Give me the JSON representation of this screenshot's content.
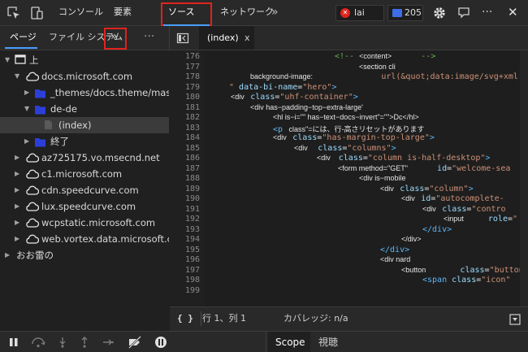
{
  "toolbar": {
    "tabs": [
      "コンソール",
      "要素",
      "ソース",
      "ネットワーク"
    ],
    "more": "»",
    "issues_count": "lai",
    "messages_count": "205",
    "overflow": "···",
    "close": "✕"
  },
  "left_panel": {
    "tabs": [
      "ページ",
      "ファイル システム"
    ],
    "more": "»",
    "overflow": "···"
  },
  "editor": {
    "file_tab": "(index)",
    "file_tab_close": "x"
  },
  "tree": [
    {
      "label": "上",
      "level": 0,
      "arrow": "down",
      "icon": "frame-icon"
    },
    {
      "label": "docs.microsoft.com",
      "level": 1,
      "arrow": "down",
      "icon": "cloud-icon"
    },
    {
      "label": "_themes/docs.theme/maste",
      "level": 2,
      "arrow": "right",
      "icon": "folder-icon"
    },
    {
      "label": "de-de",
      "level": 2,
      "arrow": "down",
      "icon": "folder-icon"
    },
    {
      "label": "(index)",
      "level": 3,
      "arrow": "",
      "icon": "file-icon",
      "selected": true
    },
    {
      "label": "終了",
      "level": 2,
      "arrow": "right",
      "icon": "folder-icon"
    },
    {
      "label": "az725175.vo.msecnd.net",
      "level": 1,
      "arrow": "right",
      "icon": "cloud-icon"
    },
    {
      "label": "c1.microsoft.com",
      "level": 1,
      "arrow": "right",
      "icon": "cloud-icon"
    },
    {
      "label": "cdn.speedcurve.com",
      "level": 1,
      "arrow": "right",
      "icon": "cloud-icon"
    },
    {
      "label": "lux.speedcurve.com",
      "level": 1,
      "arrow": "right",
      "icon": "cloud-icon"
    },
    {
      "label": "wcpstatic.microsoft.com",
      "level": 1,
      "arrow": "right",
      "icon": "cloud-icon"
    },
    {
      "label": "web.vortex.data.microsoft.co",
      "level": 1,
      "arrow": "right",
      "icon": "cloud-icon"
    },
    {
      "label": "おお雷の",
      "level": 0,
      "arrow": "right",
      "icon": ""
    }
  ],
  "code": {
    "line_numbers": [
      "176",
      "177",
      "178",
      "179",
      "180",
      "181",
      "182",
      "183",
      "184",
      "185",
      "186",
      "187",
      "188",
      "189",
      "190",
      "191",
      "192",
      "193",
      "194",
      "195",
      "196",
      "197",
      "198",
      "199"
    ],
    "lines": [
      {
        "indent": 160,
        "segs": [
          {
            "t": "<!-- ",
            "c": "c-com",
            "f": "mono"
          },
          {
            "t": "<content>",
            "c": "c-white",
            "f": "sans"
          },
          {
            "t": "      -->",
            "c": "c-com",
            "f": "mono"
          }
        ]
      },
      {
        "indent": 190,
        "segs": [
          {
            "t": "<section cli",
            "c": "c-white",
            "f": "sans"
          }
        ]
      },
      {
        "indent": 56,
        "segs": [
          {
            "t": "background-image:",
            "c": "c-white",
            "f": "sans"
          },
          {
            "t": "              url(&quot;data:image/svg+xml,%3C",
            "c": "c-val",
            "f": "mono"
          }
        ]
      },
      {
        "indent": 30,
        "segs": [
          {
            "t": "\" ",
            "c": "c-val",
            "f": "mono"
          },
          {
            "t": "data-bi-name",
            "c": "c-attr",
            "f": "mono"
          },
          {
            "t": "=",
            "c": "c-white",
            "f": "mono"
          },
          {
            "t": "\"hero\"",
            "c": "c-val",
            "f": "mono"
          },
          {
            "t": ">",
            "c": "c-tag",
            "f": "mono"
          }
        ]
      },
      {
        "indent": 32,
        "segs": [
          {
            "t": "<div   ",
            "c": "c-white",
            "f": "sans"
          },
          {
            "t": "class",
            "c": "c-attr",
            "f": "mono"
          },
          {
            "t": "=",
            "c": "c-white",
            "f": "mono"
          },
          {
            "t": "\"uhf-container\"",
            "c": "c-val",
            "f": "mono"
          },
          {
            "t": ">",
            "c": "c-tag",
            "f": "mono"
          }
        ]
      },
      {
        "indent": 56,
        "segs": [
          {
            "t": "<div has−padding−top−extra-large'",
            "c": "c-white",
            "f": "sans"
          }
        ]
      },
      {
        "indent": 84,
        "segs": [
          {
            "t": "<hl is−i=\"\" has−text−docs−invert\"=\"\">Dc</hl>",
            "c": "c-white",
            "f": "sans"
          }
        ]
      },
      {
        "indent": 84,
        "segs": [
          {
            "t": "<p",
            "c": "c-tag",
            "f": "mono"
          },
          {
            "t": "   class\"=には、行-高さリセットがあります",
            "c": "c-white",
            "f": "sans"
          }
        ]
      },
      {
        "indent": 84,
        "segs": [
          {
            "t": "<div   ",
            "c": "c-white",
            "f": "sans"
          },
          {
            "t": "class",
            "c": "c-attr",
            "f": "mono"
          },
          {
            "t": "=",
            "c": "c-white",
            "f": "mono"
          },
          {
            "t": "\"has-margin-top-large\"",
            "c": "c-val",
            "f": "mono"
          },
          {
            "t": ">",
            "c": "c-tag",
            "f": "mono"
          }
        ]
      },
      {
        "indent": 110,
        "segs": [
          {
            "t": "<div     ",
            "c": "c-white",
            "f": "sans"
          },
          {
            "t": "class",
            "c": "c-attr",
            "f": "mono"
          },
          {
            "t": "=",
            "c": "c-white",
            "f": "mono"
          },
          {
            "t": "\"columns\"",
            "c": "c-val",
            "f": "mono"
          },
          {
            "t": ">",
            "c": "c-tag",
            "f": "mono"
          }
        ]
      },
      {
        "indent": 138,
        "segs": [
          {
            "t": "<div    ",
            "c": "c-white",
            "f": "sans"
          },
          {
            "t": "class",
            "c": "c-attr",
            "f": "mono"
          },
          {
            "t": "=",
            "c": "c-white",
            "f": "mono"
          },
          {
            "t": "\"column is-half-desktop\"",
            "c": "c-val",
            "f": "mono"
          },
          {
            "t": ">",
            "c": "c-tag",
            "f": "mono"
          }
        ]
      },
      {
        "indent": 164,
        "segs": [
          {
            "t": "<form method=\"GET\"",
            "c": "c-white",
            "f": "sans"
          },
          {
            "t": "      id",
            "c": "c-attr",
            "f": "mono"
          },
          {
            "t": "=",
            "c": "c-white",
            "f": "mono"
          },
          {
            "t": "\"welcome-sea",
            "c": "c-val",
            "f": "mono"
          }
        ]
      },
      {
        "indent": 190,
        "segs": [
          {
            "t": "<div is−mobile",
            "c": "c-white",
            "f": "sans"
          }
        ]
      },
      {
        "indent": 216,
        "segs": [
          {
            "t": "<div   ",
            "c": "c-white",
            "f": "sans"
          },
          {
            "t": "class",
            "c": "c-attr",
            "f": "mono"
          },
          {
            "t": "=",
            "c": "c-white",
            "f": "mono"
          },
          {
            "t": "\"column\"",
            "c": "c-val",
            "f": "mono"
          },
          {
            "t": ">",
            "c": "c-tag",
            "f": "mono"
          }
        ]
      },
      {
        "indent": 242,
        "segs": [
          {
            "t": "<div   ",
            "c": "c-white",
            "f": "sans"
          },
          {
            "t": "id",
            "c": "c-attr",
            "f": "mono"
          },
          {
            "t": "=",
            "c": "c-white",
            "f": "mono"
          },
          {
            "t": "\"autocomplete-",
            "c": "c-val",
            "f": "mono"
          }
        ]
      },
      {
        "indent": 268,
        "segs": [
          {
            "t": "<div   ",
            "c": "c-white",
            "f": "sans"
          },
          {
            "t": "class",
            "c": "c-attr",
            "f": "mono"
          },
          {
            "t": "=",
            "c": "c-white",
            "f": "mono"
          },
          {
            "t": "\"contro",
            "c": "c-val",
            "f": "mono"
          }
        ]
      },
      {
        "indent": 294,
        "segs": [
          {
            "t": "<input",
            "c": "c-white",
            "f": "sans"
          },
          {
            "t": "     role",
            "c": "c-attr",
            "f": "mono"
          },
          {
            "t": "=",
            "c": "c-white",
            "f": "mono"
          },
          {
            "t": "\"",
            "c": "c-val",
            "f": "mono"
          }
        ]
      },
      {
        "indent": 268,
        "segs": [
          {
            "t": "</div>",
            "c": "c-tag",
            "f": "mono"
          }
        ]
      },
      {
        "indent": 242,
        "segs": [
          {
            "t": "</div>",
            "c": "c-white",
            "f": "sans"
          }
        ]
      },
      {
        "indent": 216,
        "segs": [
          {
            "t": "</div>",
            "c": "c-tag",
            "f": "mono"
          }
        ]
      },
      {
        "indent": 216,
        "segs": [
          {
            "t": "<div nard",
            "c": "c-white",
            "f": "sans"
          }
        ]
      },
      {
        "indent": 242,
        "segs": [
          {
            "t": "<button",
            "c": "c-white",
            "f": "sans"
          },
          {
            "t": "       class",
            "c": "c-attr",
            "f": "mono"
          },
          {
            "t": "=",
            "c": "c-white",
            "f": "mono"
          },
          {
            "t": "\"button",
            "c": "c-val",
            "f": "mono"
          }
        ]
      },
      {
        "indent": 268,
        "segs": [
          {
            "t": "<span ",
            "c": "c-tag",
            "f": "mono"
          },
          {
            "t": "class",
            "c": "c-attr",
            "f": "mono"
          },
          {
            "t": "=",
            "c": "c-white",
            "f": "mono"
          },
          {
            "t": "\"icon\"",
            "c": "c-val",
            "f": "mono"
          }
        ]
      },
      {
        "indent": 0,
        "segs": []
      }
    ]
  },
  "status": {
    "braces": "{ }",
    "position": "行 1、列 1",
    "coverage": "カバレッジ: n/a"
  },
  "debug": {
    "tabs": [
      "Scope",
      "視聴"
    ]
  }
}
